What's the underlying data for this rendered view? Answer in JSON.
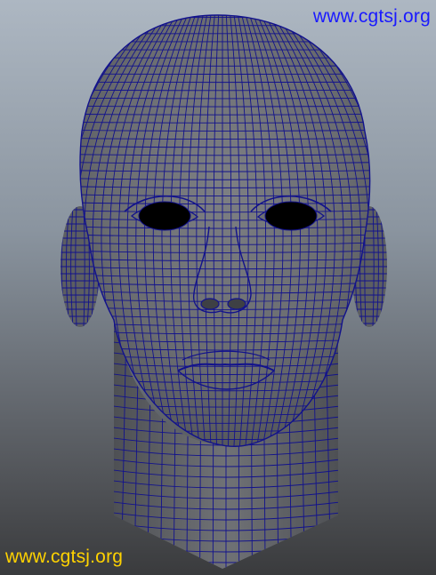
{
  "watermark_top": {
    "text": "www.cgtsj.org",
    "color": "#1a1aff"
  },
  "watermark_bottom": {
    "text": "www.cgtsj.org",
    "color": "#ffd200"
  },
  "viewport": {
    "background_top": "#adb7c2",
    "background_bottom": "#3a3b3d"
  },
  "mesh": {
    "fill_color": "#707276",
    "wire_color": "#12128c"
  }
}
